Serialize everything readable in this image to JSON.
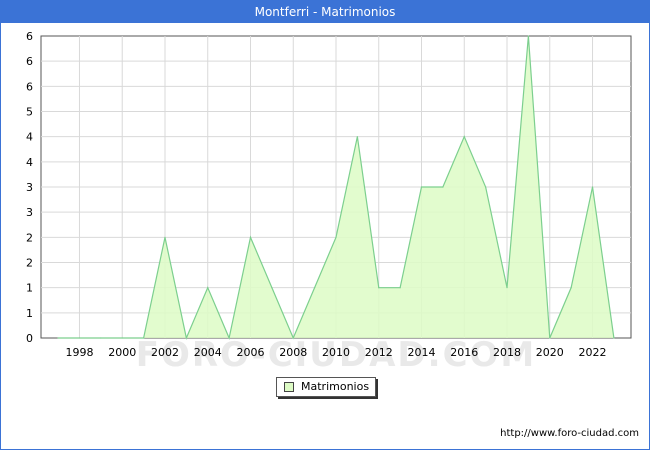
{
  "title": "Montferri - Matrimonios",
  "footer_url": "http://www.foro-ciudad.com",
  "watermark": "FORO-CIUDAD.COM",
  "colors": {
    "title_bar": "#3b73d6",
    "area_fill": "#ddfbc5",
    "area_line": "#7ccf8e",
    "grid": "#d9d9d9"
  },
  "chart_data": {
    "type": "area",
    "title": "Montferri - Matrimonios",
    "x": [
      1997,
      1998,
      1999,
      2000,
      2001,
      2002,
      2003,
      2004,
      2005,
      2006,
      2007,
      2008,
      2009,
      2010,
      2011,
      2012,
      2013,
      2014,
      2015,
      2016,
      2017,
      2018,
      2019,
      2020,
      2021,
      2022,
      2023
    ],
    "x_ticks": [
      1998,
      2000,
      2002,
      2004,
      2006,
      2008,
      2010,
      2012,
      2014,
      2016,
      2018,
      2020,
      2022
    ],
    "xlim": [
      1996.2,
      2023.8
    ],
    "y_tick_labels": [
      "0",
      "1",
      "1",
      "2",
      "2",
      "3",
      "3",
      "4",
      "4",
      "5",
      "6",
      "6",
      "6"
    ],
    "ylim": [
      0,
      6
    ],
    "grid": true,
    "legend_position": "bottom-center",
    "series": [
      {
        "name": "Matrimonios",
        "values": [
          0,
          0,
          0,
          0,
          0,
          2,
          0,
          1,
          0,
          2,
          1,
          0,
          1,
          2,
          4,
          1,
          1,
          3,
          3,
          4,
          3,
          1,
          6,
          0,
          1,
          3,
          0
        ]
      }
    ]
  }
}
